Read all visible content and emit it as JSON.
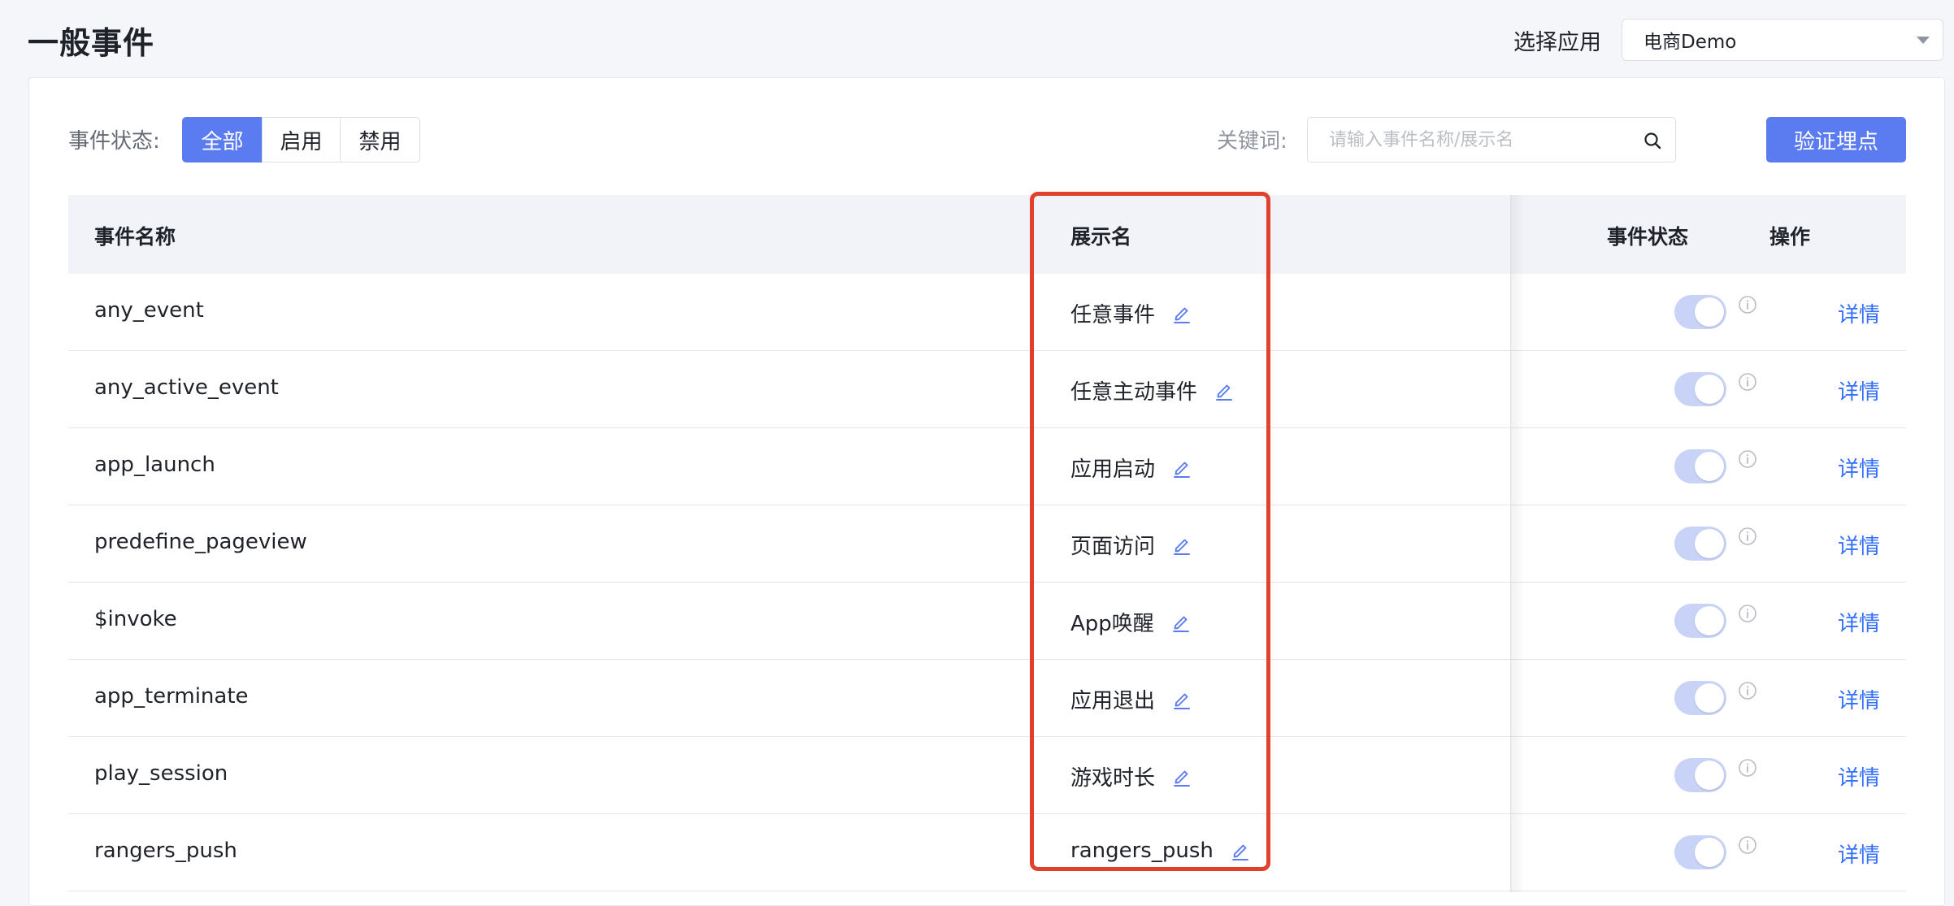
{
  "header": {
    "title": "一般事件",
    "app_select_label": "选择应用",
    "app_select_value": "电商Demo"
  },
  "filters": {
    "status_label": "事件状态:",
    "status_options": [
      "全部",
      "启用",
      "禁用"
    ],
    "status_selected": "全部",
    "keyword_label": "关键词:",
    "search_placeholder": "请输入事件名称/展示名",
    "verify_button": "验证埋点"
  },
  "table": {
    "headers": {
      "event_name": "事件名称",
      "display_name": "展示名",
      "event_status": "事件状态",
      "actions": "操作"
    },
    "rows": [
      {
        "event_name": "any_event",
        "display_name": "任意事件",
        "enabled": true,
        "action": "详情"
      },
      {
        "event_name": "any_active_event",
        "display_name": "任意主动事件",
        "enabled": true,
        "action": "详情"
      },
      {
        "event_name": "app_launch",
        "display_name": "应用启动",
        "enabled": true,
        "action": "详情"
      },
      {
        "event_name": "predefine_pageview",
        "display_name": "页面访问",
        "enabled": true,
        "action": "详情"
      },
      {
        "event_name": "$invoke",
        "display_name": "App唤醒",
        "enabled": true,
        "action": "详情"
      },
      {
        "event_name": "app_terminate",
        "display_name": "应用退出",
        "enabled": true,
        "action": "详情"
      },
      {
        "event_name": "play_session",
        "display_name": "游戏时长",
        "enabled": true,
        "action": "详情"
      },
      {
        "event_name": "rangers_push",
        "display_name": "rangers_push",
        "enabled": true,
        "action": "详情"
      }
    ]
  },
  "icons": {
    "search": "search-icon",
    "edit": "edit-icon",
    "info": "info-icon",
    "dropdown": "chevron-down-icon"
  },
  "colors": {
    "primary": "#5b7cf0",
    "link": "#3370ff",
    "highlight": "#e1402d",
    "toggle": "#c8d3f7"
  }
}
